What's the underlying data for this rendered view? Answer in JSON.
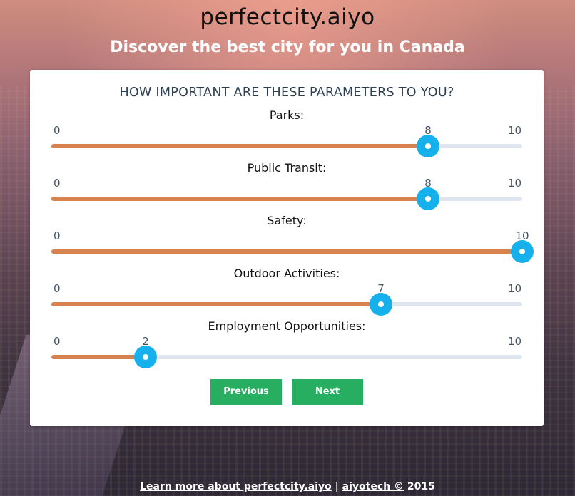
{
  "site": {
    "title": "perfectcity.aiyo",
    "tagline": "Discover the best city for you in Canada"
  },
  "card": {
    "heading": "HOW IMPORTANT ARE THESE PARAMETERS TO YOU?"
  },
  "slider_scale": {
    "min": "0",
    "max": "10"
  },
  "parameters": [
    {
      "label": "Parks:",
      "value": "8",
      "level": 8
    },
    {
      "label": "Public Transit:",
      "value": "8",
      "level": 8
    },
    {
      "label": "Safety:",
      "value": "10",
      "level": 10
    },
    {
      "label": "Outdoor Activities:",
      "value": "7",
      "level": 7
    },
    {
      "label": "Employment Opportunities:",
      "value": "2",
      "level": 2
    }
  ],
  "buttons": {
    "previous": "Previous",
    "next": "Next"
  },
  "footer": {
    "learn_more": "Learn more about perfectcity.aiyo",
    "separator": "|",
    "company": "aiyotech ©",
    "year": "2015"
  },
  "colors": {
    "track_fill": "#d8824f",
    "track_empty": "#dfe5ef",
    "thumb": "#16b1ec",
    "button": "#27ae60",
    "heading": "#2c3e50"
  }
}
